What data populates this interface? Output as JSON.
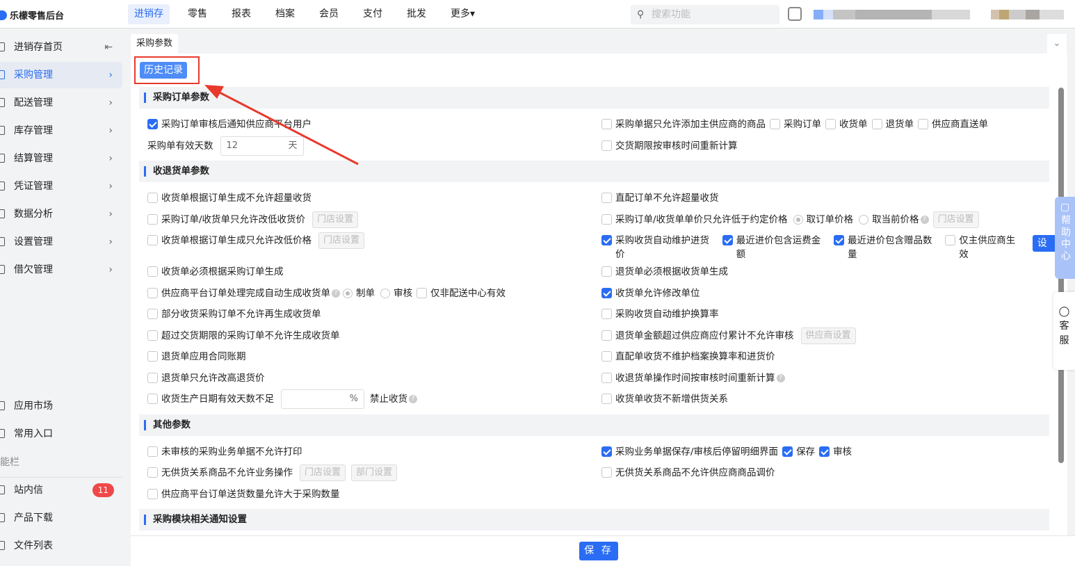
{
  "app": {
    "title": "乐檬零售后台"
  },
  "nav": [
    "进销存",
    "零售",
    "报表",
    "档案",
    "会员",
    "支付",
    "批发",
    "更多▾"
  ],
  "search": {
    "placeholder": "搜索功能"
  },
  "sidebar": {
    "items": [
      "进销存首页",
      "采购管理",
      "配送管理",
      "库存管理",
      "结算管理",
      "凭证管理",
      "数据分析",
      "设置管理",
      "借欠管理"
    ],
    "bottom": [
      "应用市场",
      "常用入口"
    ],
    "group_label": "能栏",
    "tools": [
      {
        "label": "站内信",
        "badge": "11"
      },
      {
        "label": "产品下载"
      },
      {
        "label": "文件列表"
      }
    ]
  },
  "tab": {
    "label": "采购参数"
  },
  "history_button": "历史记录",
  "sections": [
    {
      "title": "采购订单参数",
      "rows": [
        {
          "left": [
            {
              "t": "check",
              "label": "采购订单审核后通知供应商平台用户",
              "checked": true
            }
          ],
          "right": [
            {
              "t": "check",
              "label": "采购单据只允许添加主供应商的商品"
            },
            {
              "t": "check",
              "label": "采购订单"
            },
            {
              "t": "check",
              "label": "收货单"
            },
            {
              "t": "check",
              "label": "退货单"
            },
            {
              "t": "check",
              "label": "供应商直送单"
            }
          ]
        },
        {
          "left": [
            {
              "t": "text",
              "label": "采购单有效天数"
            },
            {
              "t": "input",
              "value": "12",
              "suffix": "天",
              "w": 120
            }
          ],
          "right": [
            {
              "t": "check",
              "label": "交货期限按审核时间重新计算"
            }
          ]
        }
      ]
    },
    {
      "title": "收退货单参数",
      "rows": [
        {
          "left": [
            {
              "t": "check",
              "label": "收货单根据订单生成不允许超量收货"
            }
          ],
          "right": [
            {
              "t": "check",
              "label": "直配订单不允许超量收货"
            }
          ]
        },
        {
          "left": [
            {
              "t": "check",
              "label": "采购订单/收货单只允许改低收货价"
            },
            {
              "t": "btn",
              "label": "门店设置"
            }
          ],
          "right": [
            {
              "t": "check",
              "label": "采购订单/收货单单价只允许低于约定价格"
            },
            {
              "t": "radio",
              "label": "取订单价格",
              "checked": true
            },
            {
              "t": "radio",
              "label": "取当前价格"
            },
            {
              "t": "help"
            },
            {
              "t": "btn",
              "label": "门店设置"
            }
          ]
        },
        {
          "left": [
            {
              "t": "check",
              "label": "收货单根据订单生成只允许改低价格"
            },
            {
              "t": "btn",
              "label": "门店设置"
            }
          ],
          "right": [
            {
              "t": "check",
              "label": "采购收货自动维护进货价",
              "checked": true,
              "wrap": true
            },
            {
              "t": "check",
              "label": "最近进价包含运费金额",
              "checked": true,
              "wrap": true
            },
            {
              "t": "check",
              "label": "最近进价包含赠品数量",
              "checked": true,
              "wrap": true
            },
            {
              "t": "check",
              "label": "仅主供应商生效",
              "wrap": true
            },
            {
              "t": "btn",
              "label": "设 置",
              "primary": true
            }
          ]
        },
        {
          "left": [
            {
              "t": "check",
              "label": "收货单必须根据采购订单生成"
            }
          ],
          "right": [
            {
              "t": "check",
              "label": "退货单必须根据收货单生成"
            }
          ]
        },
        {
          "left": [
            {
              "t": "check",
              "label": "供应商平台订单处理完成自动生成收货单"
            },
            {
              "t": "help"
            },
            {
              "t": "radio",
              "label": "制单",
              "checked": true
            },
            {
              "t": "radio",
              "label": "审核"
            },
            {
              "t": "check",
              "label": "仅非配送中心有效"
            }
          ],
          "right": [
            {
              "t": "check",
              "label": "收货单允许修改单位",
              "checked": true
            }
          ]
        },
        {
          "left": [
            {
              "t": "check",
              "label": "部分收货采购订单不允许再生成收货单"
            }
          ],
          "right": [
            {
              "t": "check",
              "label": "采购收货自动维护换算率"
            }
          ]
        },
        {
          "left": [
            {
              "t": "check",
              "label": "超过交货期限的采购订单不允许生成收货单"
            }
          ],
          "right": [
            {
              "t": "check",
              "label": "退货单金额超过供应商应付累计不允许审核"
            },
            {
              "t": "btn",
              "label": "供应商设置"
            }
          ]
        },
        {
          "left": [
            {
              "t": "check",
              "label": "退货单应用合同账期"
            }
          ],
          "right": [
            {
              "t": "check",
              "label": "直配单收货不维护档案换算率和进货价"
            }
          ]
        },
        {
          "left": [
            {
              "t": "check",
              "label": "退货单只允许改高退货价"
            }
          ],
          "right": [
            {
              "t": "check",
              "label": "收退货单操作时间按审核时间重新计算"
            },
            {
              "t": "help"
            }
          ]
        },
        {
          "left": [
            {
              "t": "check",
              "label": "收货生产日期有效天数不足"
            },
            {
              "t": "input",
              "value": "",
              "suffix": "%",
              "w": 120
            },
            {
              "t": "text",
              "label": "禁止收货"
            },
            {
              "t": "help"
            }
          ],
          "right": [
            {
              "t": "check",
              "label": "收货单收货不新增供货关系"
            }
          ]
        }
      ]
    },
    {
      "title": "其他参数",
      "rows": [
        {
          "left": [
            {
              "t": "check",
              "label": "未审核的采购业务单据不允许打印"
            }
          ],
          "right": [
            {
              "t": "check",
              "label": "采购业务单据保存/审核后停留明细界面",
              "checked": true
            },
            {
              "t": "check",
              "label": "保存",
              "checked": true
            },
            {
              "t": "check",
              "label": "审核",
              "checked": true
            }
          ]
        },
        {
          "left": [
            {
              "t": "check",
              "label": "无供货关系商品不允许业务操作"
            },
            {
              "t": "btn",
              "label": "门店设置"
            },
            {
              "t": "btn",
              "label": "部门设置"
            }
          ],
          "right": [
            {
              "t": "check",
              "label": "无供货关系商品不允许供应商商品调价"
            }
          ]
        },
        {
          "left": [
            {
              "t": "check",
              "label": "供应商平台订单送货数量允许大于采购数量"
            }
          ],
          "right": []
        }
      ]
    },
    {
      "title": "采购模块相关通知设置",
      "rows": []
    }
  ],
  "footer": {
    "save": "保 存"
  },
  "float": {
    "help": "帮助中心",
    "service": "客服"
  }
}
